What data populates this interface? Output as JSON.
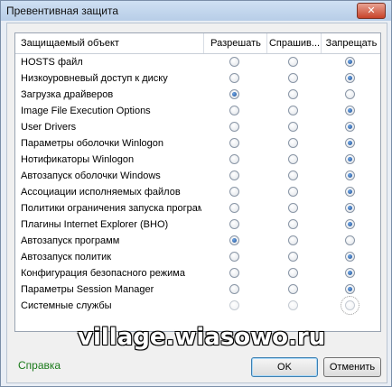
{
  "window": {
    "title": "Превентивная защита",
    "close_glyph": "✕"
  },
  "columns": {
    "object": "Защищаемый объект",
    "allow": "Разрешать",
    "ask": "Спрашив...",
    "deny": "Запрещать"
  },
  "rows": [
    {
      "label": "HOSTS файл",
      "state": "deny"
    },
    {
      "label": "Низкоуровневый доступ к диску",
      "state": "deny"
    },
    {
      "label": "Загрузка драйверов",
      "state": "allow"
    },
    {
      "label": "Image File Execution Options",
      "state": "deny"
    },
    {
      "label": "User Drivers",
      "state": "deny"
    },
    {
      "label": "Параметры оболочки Winlogon",
      "state": "deny"
    },
    {
      "label": "Нотификаторы Winlogon",
      "state": "deny"
    },
    {
      "label": "Автозапуск оболочки Windows",
      "state": "deny"
    },
    {
      "label": "Ассоциации исполняемых файлов",
      "state": "deny"
    },
    {
      "label": "Политики ограничения запуска програм...",
      "state": "deny"
    },
    {
      "label": "Плагины Internet Explorer (BHO)",
      "state": "deny"
    },
    {
      "label": "Автозапуск программ",
      "state": "allow"
    },
    {
      "label": "Автозапуск политик",
      "state": "deny"
    },
    {
      "label": "Конфигурация безопасного режима",
      "state": "deny"
    },
    {
      "label": "Параметры Session Manager",
      "state": "deny"
    },
    {
      "label": "Системные службы",
      "state": "none",
      "focus": "deny",
      "disabled": true
    }
  ],
  "watermark": "village.wiasowo.ru",
  "footer": {
    "help": "Справка",
    "ok": "OK",
    "cancel": "Отменить"
  }
}
